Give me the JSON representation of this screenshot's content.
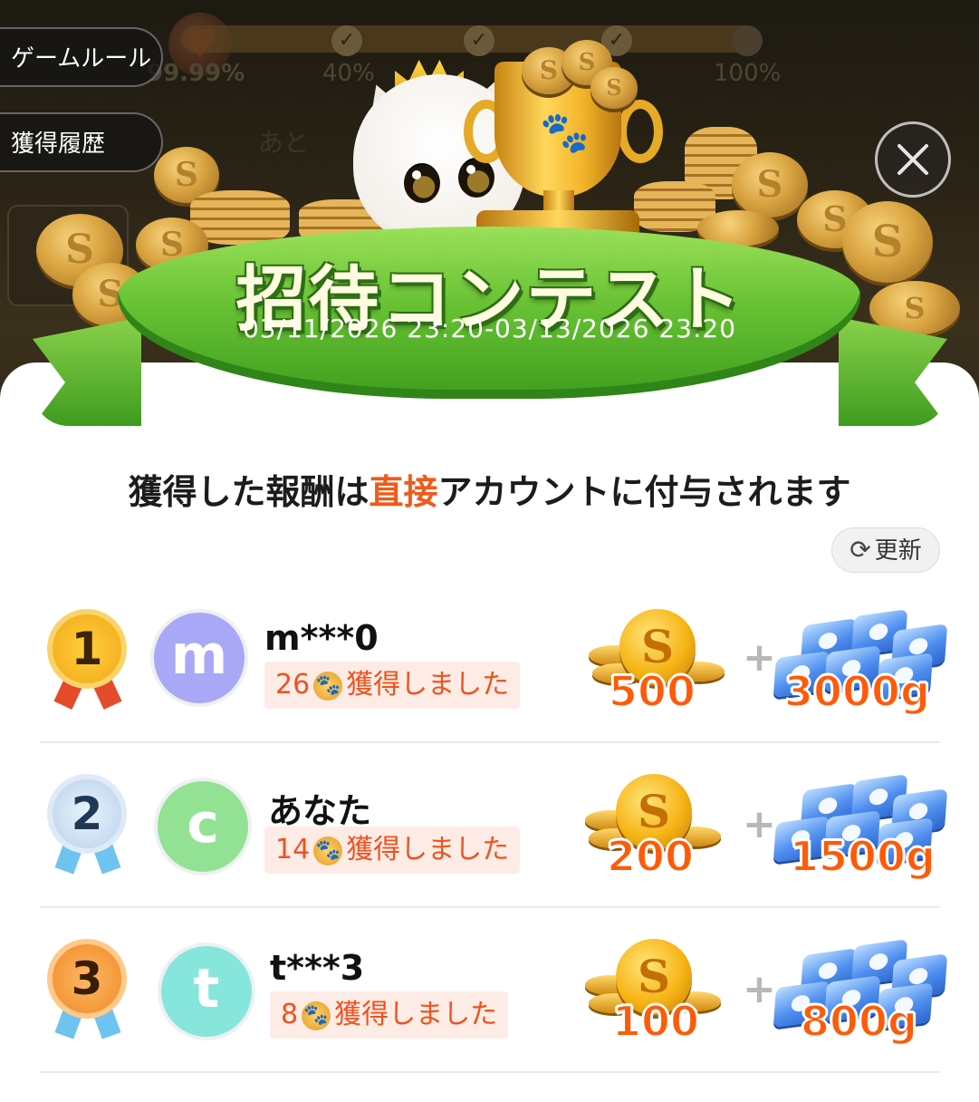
{
  "header": {
    "progress_percent": "99.99%",
    "milestones": [
      "40%",
      "100%"
    ],
    "hint_text": "あと",
    "side_buttons": {
      "rules": "ゲームルール",
      "history": "獲得履歴"
    },
    "close_icon": "close-icon"
  },
  "banner": {
    "title": "招待コンテスト",
    "period": "03/11/2026 23:20-03/13/2026 23:20"
  },
  "notice": {
    "before": "獲得した報酬は",
    "highlight": "直接",
    "after": "アカウントに付与されます",
    "highlight_color": "#f05a1a"
  },
  "refresh": {
    "label": "更新",
    "icon": "refresh-icon"
  },
  "ranking": [
    {
      "rank": "1",
      "avatar_letter": "m",
      "avatar_color": "#a9a8f7",
      "name": "m***0",
      "count": "26",
      "earned_label": "獲得しました",
      "coins": "500",
      "gems": "3000g"
    },
    {
      "rank": "2",
      "avatar_letter": "c",
      "avatar_color": "#93e293",
      "name": "あなた",
      "count": "14",
      "earned_label": "獲得しました",
      "coins": "200",
      "gems": "1500g"
    },
    {
      "rank": "3",
      "avatar_letter": "t",
      "avatar_color": "#86e6dc",
      "name": "t***3",
      "count": "8",
      "earned_label": "獲得しました",
      "coins": "100",
      "gems": "800g"
    }
  ],
  "plus_sign": "+",
  "colors": {
    "gold_medal": "#f2b728",
    "silver_medal": "#b8d2ec",
    "bronze_medal": "#f29a3c",
    "amount": "#ff5a08",
    "ribbon_green": "#68c234"
  }
}
